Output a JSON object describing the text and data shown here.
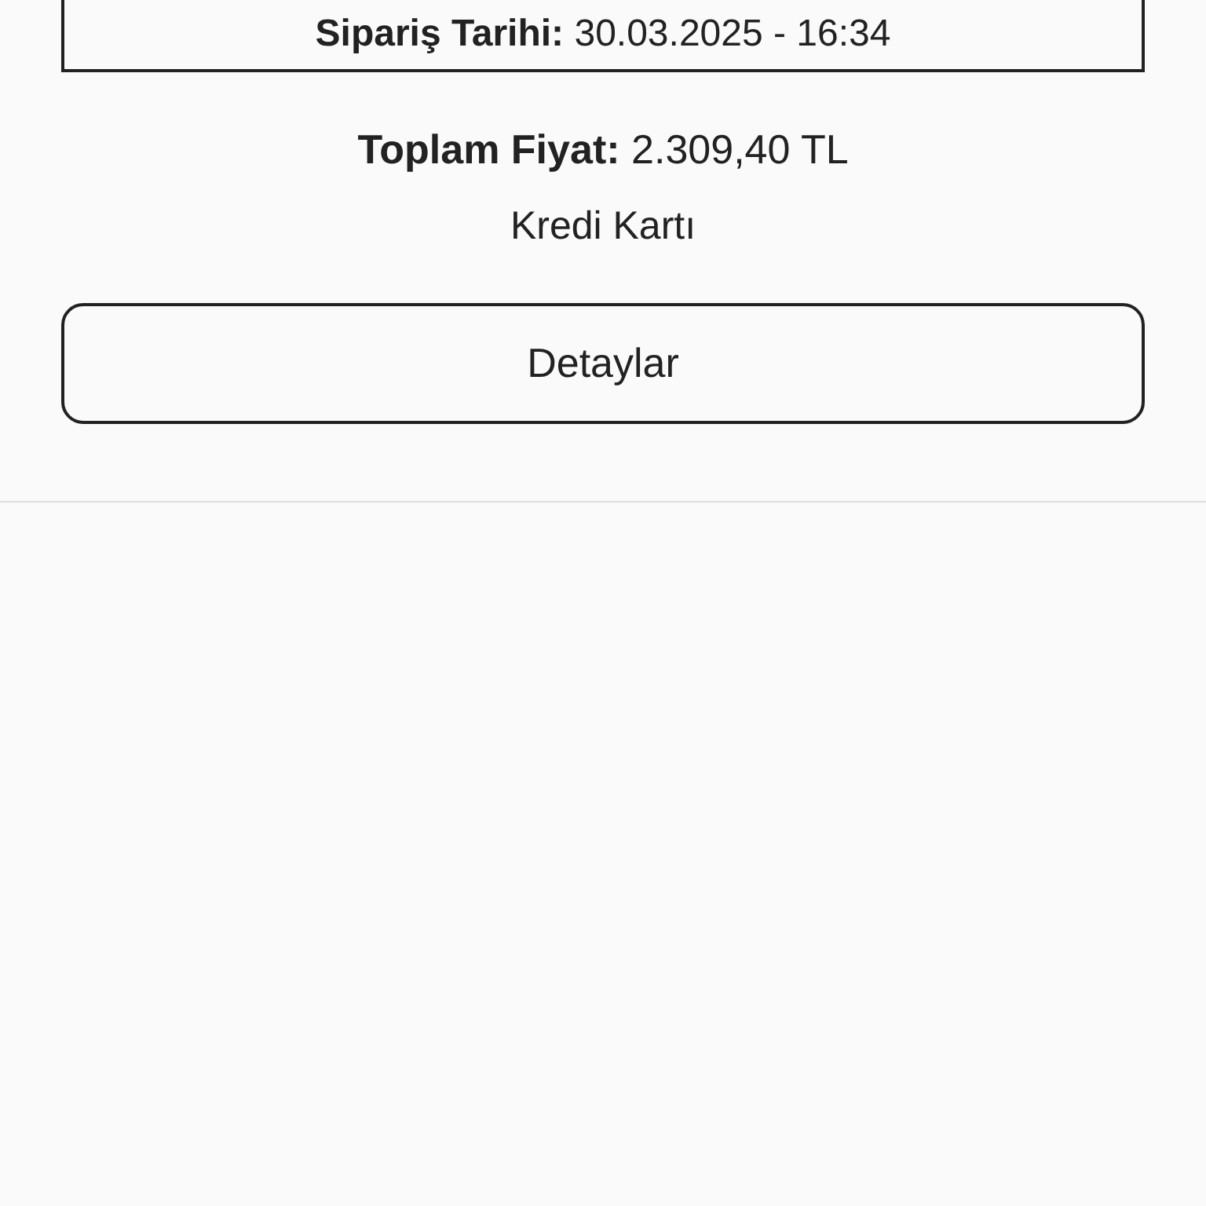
{
  "order_date": "**Sipariş Tarihi:** 30.03.2025 - 16:34",
  "total_price": "**Toplam Fiyat:** 2.309,40 TL",
  "payment_method": "Kredi Kartı",
  "details_button": "Detaylar"
}
